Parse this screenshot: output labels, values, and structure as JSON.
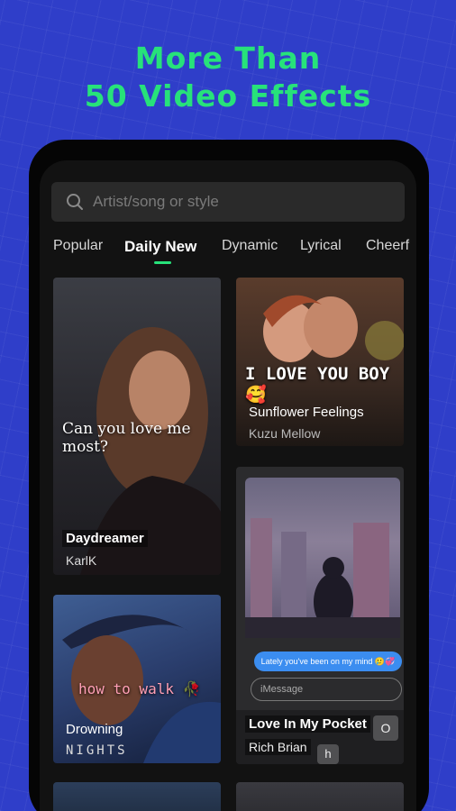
{
  "headline": {
    "line1": "More Than",
    "line2": "50 Video Effects"
  },
  "search": {
    "placeholder": "Artist/song or style"
  },
  "tabs": [
    {
      "label": "Popular"
    },
    {
      "label": "Daily New"
    },
    {
      "label": "Dynamic"
    },
    {
      "label": "Lyrical"
    },
    {
      "label": "Cheerf"
    }
  ],
  "active_tab": "Daily New",
  "cards": [
    {
      "overlay": "Can you love me most?",
      "title": "Daydreamer",
      "artist": "KarlK"
    },
    {
      "overlay": "I LOVE YOU BOY 🥰",
      "title": "Sunflower Feelings",
      "artist": "Kuzu Mellow"
    },
    {
      "overlay": "how to walk 🥀",
      "title": "Drowning",
      "artist": "NIGHTS"
    },
    {
      "chat_bubble": "Lately you've been on my mind 🥲💞",
      "imessage": "iMessage",
      "key_o": "O",
      "key_h": "h",
      "title": "Love In My Pocket",
      "artist": "Rich Brian"
    }
  ],
  "colors": {
    "background": "#2f3ec9",
    "accent": "#27e27a",
    "screen": "#121212"
  }
}
